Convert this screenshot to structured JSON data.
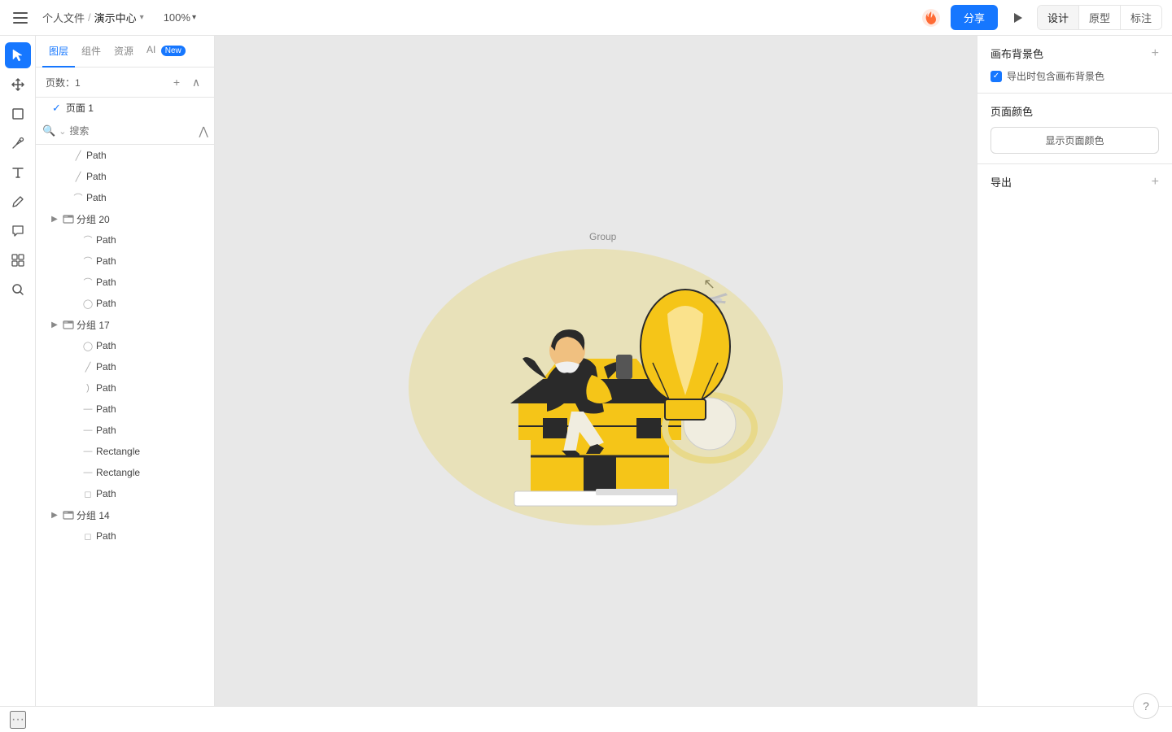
{
  "topbar": {
    "menu_label": "☰",
    "breadcrumb": "个人文件",
    "sep": "/",
    "title": "演示中心",
    "chevron": "▾",
    "zoom": "100%",
    "zoom_chevron": "▾",
    "share_label": "分享",
    "mode_tabs": [
      "设计",
      "原型",
      "标注"
    ],
    "active_mode": "设计"
  },
  "tabs": {
    "items": [
      "图层",
      "组件",
      "资源",
      "AI"
    ],
    "active": "图层",
    "new_tab": "AI",
    "new_label": "New"
  },
  "layers": {
    "pages_label": "页数：1",
    "page_items": [
      {
        "label": "页面 1",
        "active": true
      }
    ],
    "search_placeholder": "搜索",
    "items": [
      {
        "id": "path1",
        "label": "Path",
        "level": 1,
        "icon": "path",
        "expand": false
      },
      {
        "id": "path2",
        "label": "Path",
        "level": 1,
        "icon": "path",
        "expand": false
      },
      {
        "id": "path3",
        "label": "Path",
        "level": 1,
        "icon": "path",
        "expand": false
      },
      {
        "id": "group20",
        "label": "分组 20",
        "level": 1,
        "icon": "group",
        "expand": true
      },
      {
        "id": "path4",
        "label": "Path",
        "level": 2,
        "icon": "path",
        "expand": false
      },
      {
        "id": "path5",
        "label": "Path",
        "level": 2,
        "icon": "path",
        "expand": false
      },
      {
        "id": "path6",
        "label": "Path",
        "level": 2,
        "icon": "path",
        "expand": false
      },
      {
        "id": "path7",
        "label": "Path",
        "level": 2,
        "icon": "path",
        "expand": false
      },
      {
        "id": "group17",
        "label": "分组 17",
        "level": 1,
        "icon": "group",
        "expand": true
      },
      {
        "id": "path8",
        "label": "Path",
        "level": 2,
        "icon": "path",
        "expand": false
      },
      {
        "id": "path9",
        "label": "Path",
        "level": 2,
        "icon": "path",
        "expand": false
      },
      {
        "id": "path10",
        "label": "Path",
        "level": 2,
        "icon": "path",
        "expand": false
      },
      {
        "id": "path11",
        "label": "Path",
        "level": 2,
        "icon": "path",
        "expand": false
      },
      {
        "id": "path12",
        "label": "Path",
        "level": 2,
        "icon": "path",
        "expand": false
      },
      {
        "id": "rect1",
        "label": "Rectangle",
        "level": 2,
        "icon": "rect",
        "expand": false
      },
      {
        "id": "rect2",
        "label": "Rectangle",
        "level": 2,
        "icon": "rect",
        "expand": false
      },
      {
        "id": "path13",
        "label": "Path",
        "level": 2,
        "icon": "path",
        "expand": false
      },
      {
        "id": "group14",
        "label": "分组 14",
        "level": 1,
        "icon": "group",
        "expand": true
      },
      {
        "id": "path14",
        "label": "Path",
        "level": 2,
        "icon": "path",
        "expand": false
      }
    ]
  },
  "right_panel": {
    "canvas_bg_title": "画布背景色",
    "export_include_label": "导出时包含画布背景色",
    "page_color_title": "页面颜色",
    "show_page_color_btn": "显示页面颜色",
    "export_title": "导出"
  },
  "canvas": {
    "group_label": "Group"
  },
  "help_label": "?"
}
